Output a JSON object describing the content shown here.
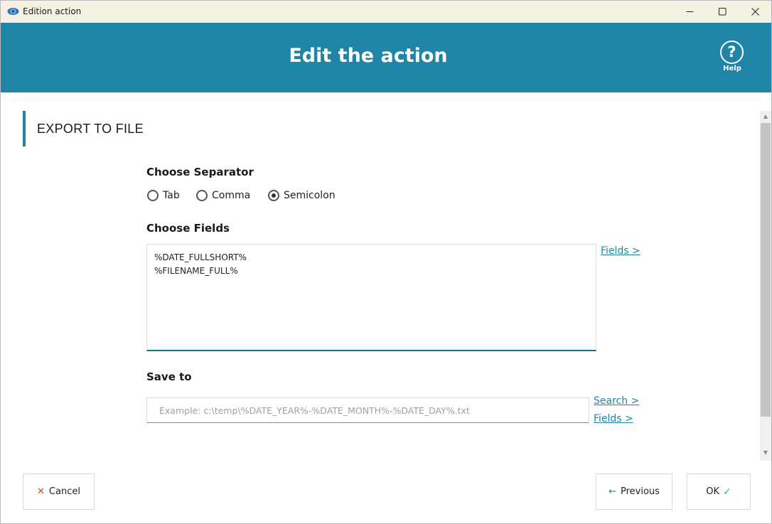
{
  "window": {
    "title": "Edition action"
  },
  "header": {
    "title": "Edit the action",
    "help_glyph": "?",
    "help_label": "Help"
  },
  "section": {
    "title": "EXPORT TO FILE"
  },
  "separator": {
    "heading": "Choose Separator",
    "options": [
      {
        "label": "Tab",
        "checked": false
      },
      {
        "label": "Comma",
        "checked": false
      },
      {
        "label": "Semicolon",
        "checked": true
      }
    ]
  },
  "fields": {
    "heading": "Choose Fields",
    "lines": [
      "%DATE_FULLSHORT%",
      "%FILENAME_FULL%"
    ],
    "link": "Fields >"
  },
  "save_to": {
    "heading": "Save to",
    "placeholder": "Example: c:\\temp\\%DATE_YEAR%-%DATE_MONTH%-%DATE_DAY%.txt",
    "search_link": "Search >",
    "fields_link": "Fields >"
  },
  "footer": {
    "cancel_label": "Cancel",
    "previous_label": "Previous",
    "ok_label": "OK"
  },
  "colors": {
    "accent": "#1f84a6",
    "titlebar": "#f5f1e3",
    "cancel_x": "#e04040",
    "ok_check": "#2eb872"
  }
}
